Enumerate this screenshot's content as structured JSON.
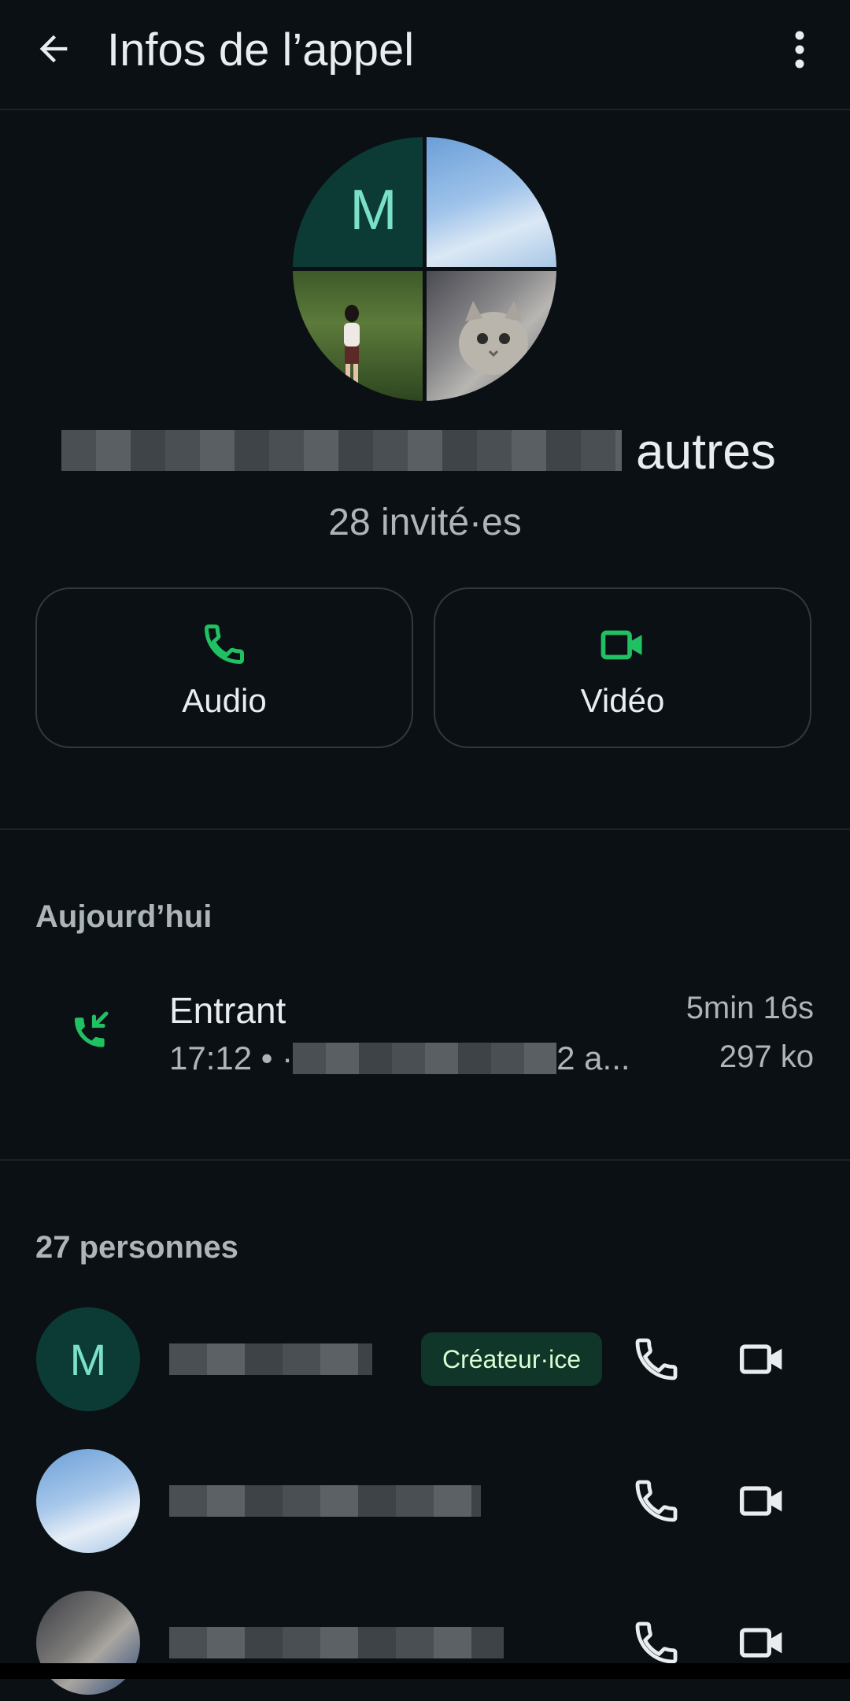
{
  "header": {
    "title": "Infos de l’appel",
    "back_icon": "arrow-back-icon",
    "menu_icon": "more-vertical-icon"
  },
  "group": {
    "avatar_initial": "M",
    "name_suffix": "autres",
    "invited": "28 invité·es"
  },
  "actions": [
    {
      "label": "Audio",
      "icon": "phone-icon"
    },
    {
      "label": "Vidéo",
      "icon": "video-icon"
    }
  ],
  "history": {
    "section": "Aujourd’hui",
    "call": {
      "type": "Entrant",
      "time": "17:12 • ·",
      "subtitle_suffix": "2 a...",
      "duration": "5min 16s",
      "size": "297 ko",
      "icon": "incoming-call-icon"
    }
  },
  "participants": {
    "section": "27 personnes",
    "creator_badge": "Créateur·ice",
    "first_initial": "M"
  },
  "colors": {
    "background": "#0b1014",
    "accent": "#21c063",
    "badge_bg": "#103529",
    "secondary_text": "#aeb5b9"
  }
}
